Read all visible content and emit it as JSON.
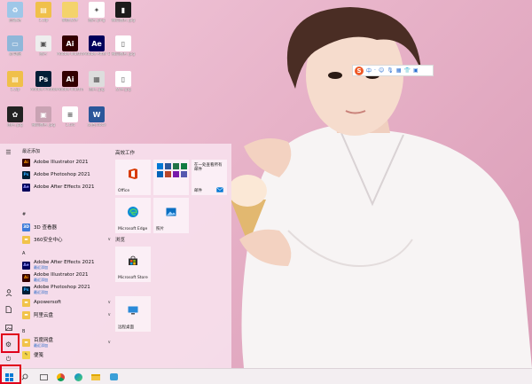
{
  "desktop": {
    "icons": [
      {
        "label": "回收站",
        "name": "recycle-bin-icon",
        "color": "#9ec7e8",
        "glyph": "♻"
      },
      {
        "label": "1.zip",
        "name": "zip-archive-icon",
        "color": "#f0c04a",
        "glyph": "▤"
      },
      {
        "label": "新建文件",
        "name": "folder-icon",
        "color": "#f4d36b",
        "glyph": ""
      },
      {
        "label": "图片.png",
        "name": "image-file-icon",
        "color": "#ffffff",
        "glyph": "✦"
      },
      {
        "label": "微信图片.jpg",
        "name": "image-file-icon-2",
        "color": "#1b1b1b",
        "glyph": "▮"
      },
      {
        "label": "此电脑",
        "name": "this-pc-icon",
        "color": "#8fb7d9",
        "glyph": "▭"
      },
      {
        "label": "图片",
        "name": "picture-folder-icon",
        "color": "#eeeeee",
        "glyph": "▣"
      },
      {
        "label": "Adobe Illustrator 2021",
        "name": "illustrator-icon",
        "color": "#330000",
        "glyph": "Ai"
      },
      {
        "label": "Adobe After Effects 2021",
        "name": "after-effects-icon",
        "color": "#00005b",
        "glyph": "Ae"
      },
      {
        "label": "微信图片.jpg",
        "name": "phone-image-icon",
        "color": "#ffffff",
        "glyph": "▯"
      },
      {
        "label": "1.zip",
        "name": "zip-archive-icon-2",
        "color": "#f0c04a",
        "glyph": "▤"
      },
      {
        "label": "Adobe Photoshop",
        "name": "photoshop-icon",
        "color": "#001e36",
        "glyph": "Ps"
      },
      {
        "label": "Adobe Illustrator",
        "name": "illustrator-icon-2",
        "color": "#330000",
        "glyph": "Ai"
      },
      {
        "label": "图片.jpg",
        "name": "qr-image-icon",
        "color": "#dddddd",
        "glyph": "▦"
      },
      {
        "label": "文件.jpg",
        "name": "document-image-icon",
        "color": "#ffffff",
        "glyph": "▯"
      },
      {
        "label": "图片.jpg",
        "name": "cat-image-icon",
        "color": "#222222",
        "glyph": "✿"
      },
      {
        "label": "微信图片.jpg",
        "name": "photo-file-icon",
        "color": "#c9a3b3",
        "glyph": "▣"
      },
      {
        "label": "1.txt",
        "name": "text-file-icon",
        "color": "#ffffff",
        "glyph": "≡"
      },
      {
        "label": "文档.docx",
        "name": "word-doc-icon",
        "color": "#2b579a",
        "glyph": "W"
      }
    ]
  },
  "ime": {
    "logo": "S",
    "items": [
      "中",
      "·",
      "☺",
      "🎙",
      "▦",
      "👕",
      "▣"
    ]
  },
  "start_menu": {
    "recent_header": "最近添加",
    "recent": [
      {
        "name": "Adobe Illustrator 2021",
        "icon": "Ai",
        "color": "#330000",
        "fg": "#ff9a00"
      },
      {
        "name": "Adobe Photoshop 2021",
        "icon": "Ps",
        "color": "#001e36",
        "fg": "#31a8ff"
      },
      {
        "name": "Adobe After Effects 2021",
        "icon": "Ae",
        "color": "#00005b",
        "fg": "#9999ff"
      }
    ],
    "hash_header": "#",
    "hash_apps": [
      {
        "name": "3D 查看器",
        "icon": "3D",
        "color": "#3d7bd9",
        "fg": "#ffffff",
        "sub": "",
        "chev": ""
      },
      {
        "name": "360安全中心",
        "icon": "▬",
        "color": "#f1c34a",
        "fg": "#ffffff",
        "sub": "",
        "chev": "∨"
      }
    ],
    "a_header": "A",
    "a_apps": [
      {
        "name": "Adobe After Effects 2021",
        "icon": "Ae",
        "color": "#00005b",
        "fg": "#9999ff",
        "sub": "最近添加",
        "chev": ""
      },
      {
        "name": "Adobe Illustrator 2021",
        "icon": "Ai",
        "color": "#330000",
        "fg": "#ff9a00",
        "sub": "最近添加",
        "chev": ""
      },
      {
        "name": "Adobe Photoshop 2021",
        "icon": "Ps",
        "color": "#001e36",
        "fg": "#31a8ff",
        "sub": "最近添加",
        "chev": ""
      },
      {
        "name": "Apowersoft",
        "icon": "▬",
        "color": "#f1c34a",
        "fg": "#ffffff",
        "sub": "",
        "chev": "∨"
      },
      {
        "name": "阿里云盘",
        "icon": "▬",
        "color": "#f1c34a",
        "fg": "#ffffff",
        "sub": "",
        "chev": "∨"
      }
    ],
    "b_header": "B",
    "b_apps": [
      {
        "name": "百度网盘",
        "icon": "▬",
        "color": "#f1c34a",
        "fg": "#ffffff",
        "sub": "最近添加",
        "chev": "∨"
      },
      {
        "name": "便笺",
        "icon": "✎",
        "color": "#f2d24a",
        "fg": "#333333",
        "sub": "",
        "chev": ""
      }
    ],
    "tile_groups": [
      {
        "title": "高效工作"
      },
      {
        "title": "浏览"
      }
    ],
    "tiles": {
      "office": "Office",
      "mail_title": "在一处查看所有邮件",
      "mail": "邮件",
      "edge": "Microsoft Edge",
      "photos": "照片",
      "store": "Microsoft Store",
      "remote": "远程桌面"
    }
  },
  "colors": {
    "highlight": "#e0001b",
    "accent": "#0078d4"
  }
}
